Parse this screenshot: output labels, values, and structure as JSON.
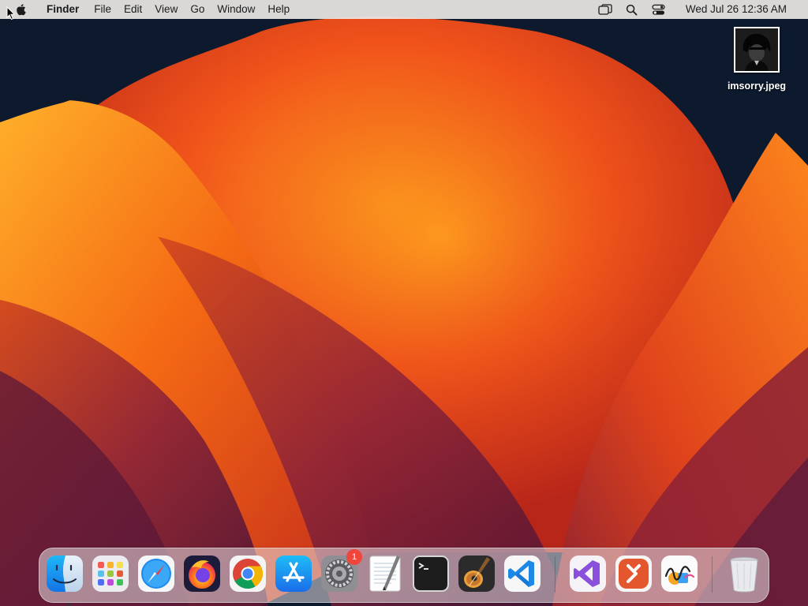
{
  "menubar": {
    "app_name": "Finder",
    "menus": [
      "File",
      "Edit",
      "View",
      "Go",
      "Window",
      "Help"
    ],
    "status_icons": [
      "window-icon",
      "search-icon",
      "control-center-icon"
    ],
    "clock": "Wed Jul 26  12:36 AM"
  },
  "desktop": {
    "file_name": "imsorry.jpeg"
  },
  "dock": {
    "settings_badge": "1",
    "apps": [
      "finder",
      "launchpad",
      "safari",
      "firefox",
      "chrome",
      "app-store",
      "system-settings",
      "textedit",
      "terminal",
      "garageband",
      "vscode",
      "visual-studio",
      "remote-desktop",
      "freeform",
      "trash"
    ]
  },
  "colors": {
    "menubar_bg": "#ece8e6",
    "badge": "#f0453a",
    "wallpaper_orange": "#ff8a1c",
    "wallpaper_red": "#d5301a",
    "wallpaper_purple": "#6a1e3e",
    "wallpaper_navy": "#0d1a2e"
  }
}
